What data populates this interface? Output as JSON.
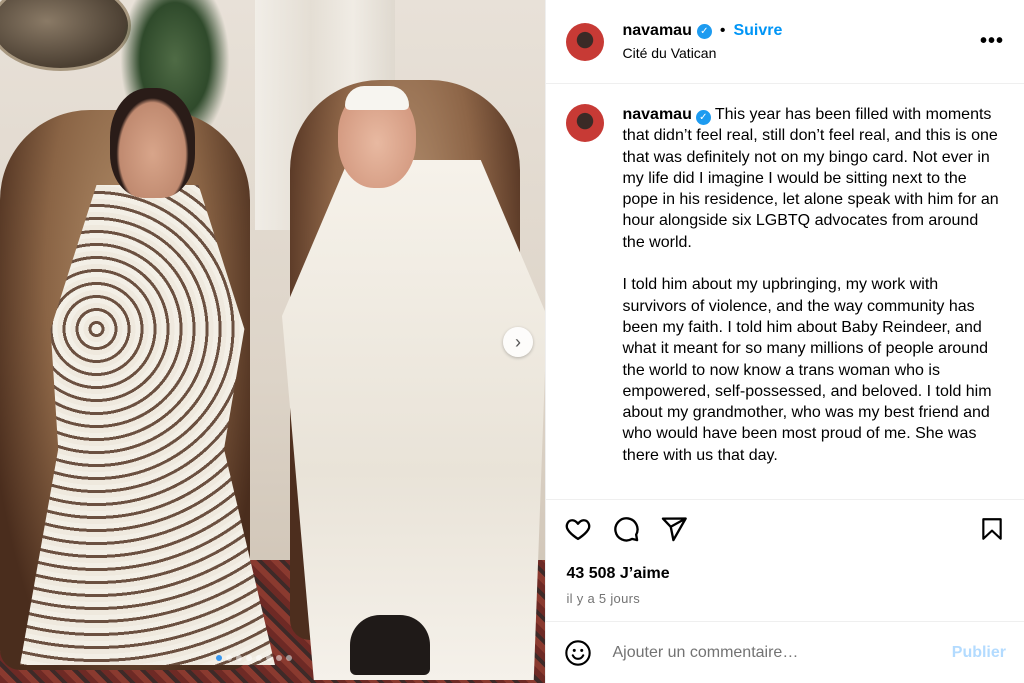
{
  "post": {
    "author": {
      "username": "navamau",
      "verified_icon": "verified-badge-icon",
      "follow_label": "Suivre",
      "location": "Cité du Vatican"
    },
    "caption": "This year has been filled with moments that didn’t feel real, still don’t feel real, and this is one that was definitely not on my bingo card. Not ever in my life did I imagine I would be sitting next to the pope in his residence, let alone speak with him for an hour alongside six LGBTQ advocates from around the world.\n\nI told him about my upbringing, my work with survivors of violence, and the way community has been my faith. I told him about Baby Reindeer, and what it meant for so many millions of people around the world to now know a trans woman who is empowered, self-possessed, and beloved. I told him about my grandmother, who was my best friend and who would have been most proud of me. She was there with us that day.",
    "likes": "43 508 J’aime",
    "date": "il y a 5 jours",
    "carousel": {
      "dots": 8,
      "active": 0
    }
  },
  "comment": {
    "placeholder": "Ajouter un commentaire…",
    "publish_label": "Publier"
  },
  "colors": {
    "accent": "#0095f6",
    "publish_disabled": "#b3dbff",
    "muted": "#737373"
  }
}
